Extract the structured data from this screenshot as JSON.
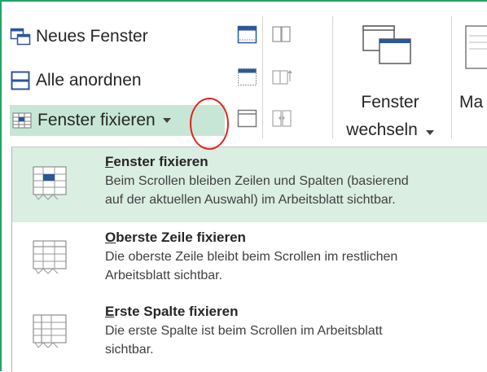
{
  "ribbon": {
    "new_window": "Neues Fenster",
    "arrange_all": "Alle anordnen",
    "freeze_panes": "Fenster fixieren",
    "switch_line1": "Fenster",
    "switch_line2": "wechseln",
    "macros_partial": "Ma"
  },
  "menu": {
    "items": [
      {
        "accel": "F",
        "title_rest": "enster fixieren",
        "desc1": "Beim Scrollen bleiben Zeilen und Spalten (basierend",
        "desc2": "auf der aktuellen Auswahl) im Arbeitsblatt sichtbar."
      },
      {
        "accel": "O",
        "title_rest": "berste Zeile fixieren",
        "desc1": "Die oberste Zeile bleibt beim Scrollen im restlichen",
        "desc2": "Arbeitsblatt sichtbar."
      },
      {
        "accel": "E",
        "title_rest": "rste Spalte fixieren",
        "desc1": "Die erste Spalte ist beim Scrollen im Arbeitsblatt",
        "desc2": "sichtbar."
      }
    ]
  },
  "colors": {
    "accent_green": "#21a366",
    "highlight": "#daeee2",
    "annotation_red": "#e3231b"
  }
}
